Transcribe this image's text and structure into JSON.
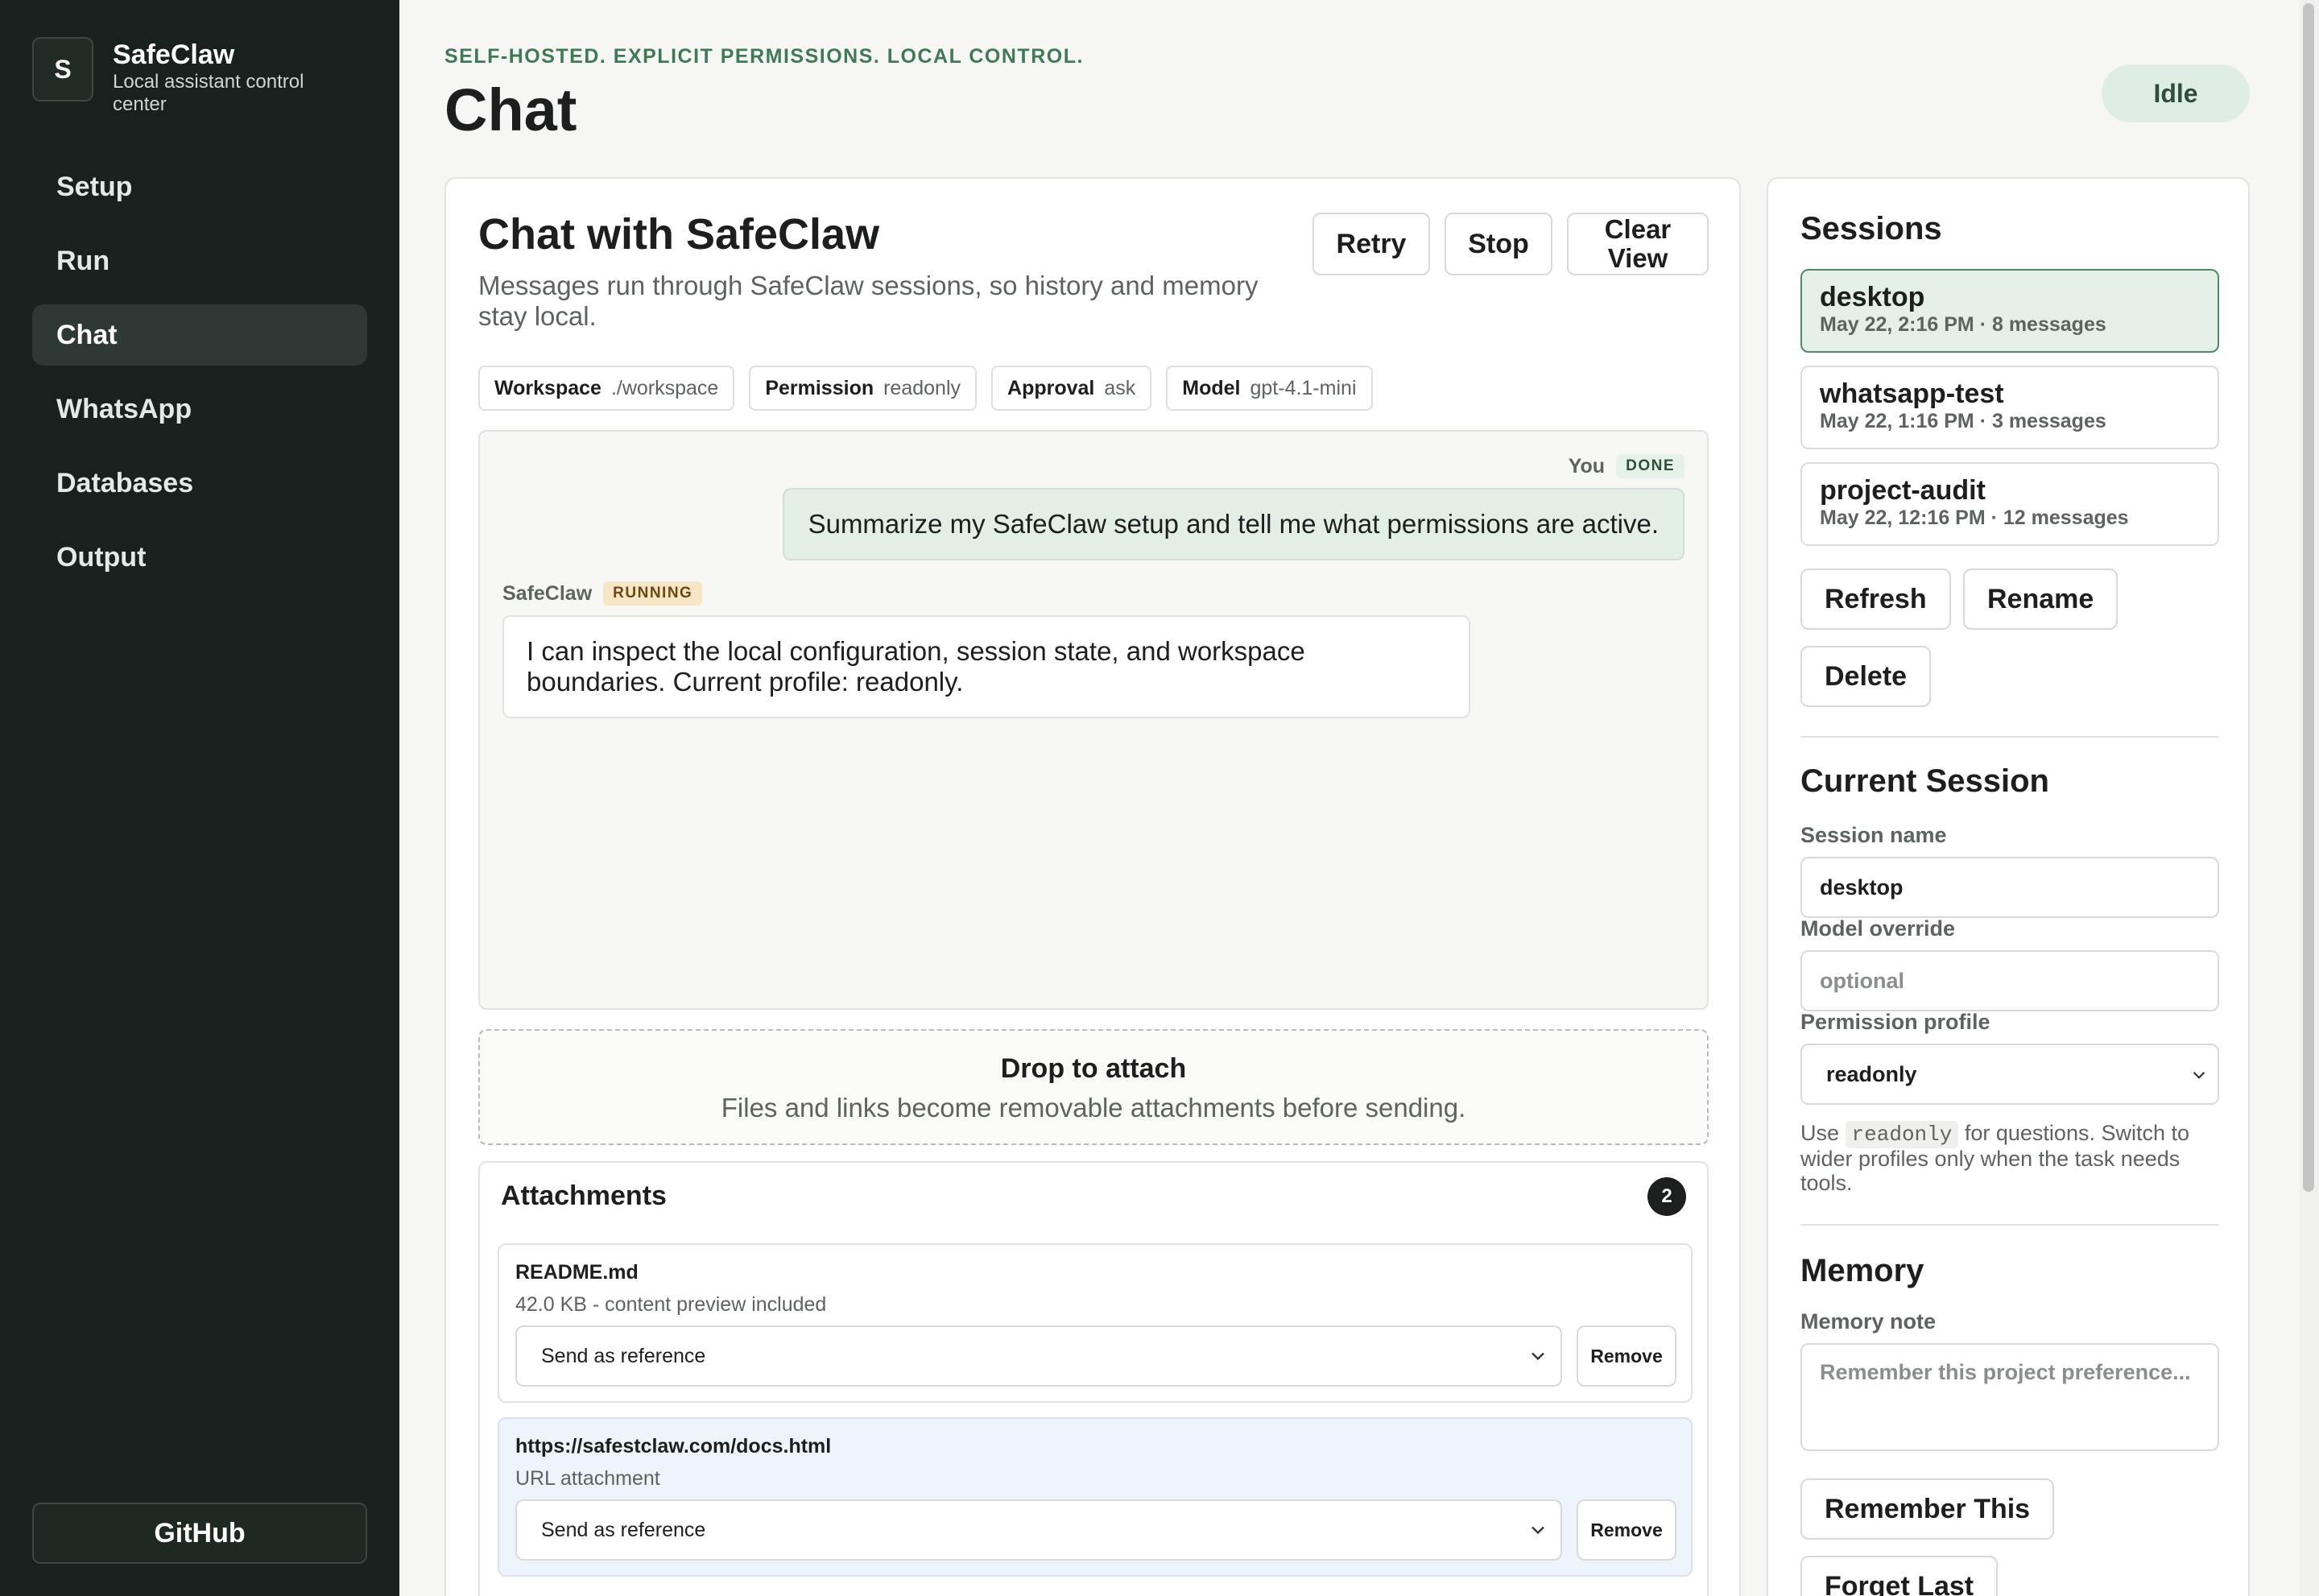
{
  "brand": {
    "initial": "S",
    "name": "SafeClaw",
    "tagline": "Local assistant control center"
  },
  "nav": {
    "items": [
      {
        "label": "Setup"
      },
      {
        "label": "Run"
      },
      {
        "label": "Chat"
      },
      {
        "label": "WhatsApp"
      },
      {
        "label": "Databases"
      },
      {
        "label": "Output"
      }
    ],
    "active": "Chat",
    "github_label": "GitHub"
  },
  "header": {
    "eyebrow": "SELF-HOSTED. EXPLICIT PERMISSIONS. LOCAL CONTROL.",
    "title": "Chat",
    "status": "Idle"
  },
  "chat": {
    "title": "Chat with SafeClaw",
    "subtitle": "Messages run through SafeClaw sessions, so history and memory stay local.",
    "buttons": {
      "retry": "Retry",
      "stop": "Stop",
      "clear": "Clear View"
    },
    "chips": [
      {
        "key": "Workspace",
        "value": "./workspace"
      },
      {
        "key": "Permission",
        "value": "readonly"
      },
      {
        "key": "Approval",
        "value": "ask"
      },
      {
        "key": "Model",
        "value": "gpt-4.1-mini"
      }
    ],
    "messages": {
      "user": {
        "author": "You",
        "status": "DONE",
        "text": "Summarize my SafeClaw setup and tell me what permissions are active."
      },
      "assistant": {
        "author": "SafeClaw",
        "status": "RUNNING",
        "text": "I can inspect the local configuration, session state, and workspace boundaries. Current profile: readonly."
      }
    },
    "dropzone": {
      "title": "Drop to attach",
      "subtitle": "Files and links become removable attachments before sending."
    },
    "attachments": {
      "title": "Attachments",
      "count": "2",
      "items": [
        {
          "name": "README.md",
          "meta": "42.0 KB - content preview included",
          "mode": "Send as reference",
          "remove": "Remove"
        },
        {
          "name": "https://safestclaw.com/docs.html",
          "meta": "URL attachment",
          "mode": "Send as reference",
          "remove": "Remove"
        }
      ]
    }
  },
  "sessions": {
    "title": "Sessions",
    "list": [
      {
        "name": "desktop",
        "meta": "May 22, 2:16 PM · 8 messages"
      },
      {
        "name": "whatsapp-test",
        "meta": "May 22, 1:16 PM · 3 messages"
      },
      {
        "name": "project-audit",
        "meta": "May 22, 12:16 PM · 12 messages"
      }
    ],
    "active": "desktop",
    "buttons": {
      "refresh": "Refresh",
      "rename": "Rename",
      "delete": "Delete"
    }
  },
  "current_session": {
    "title": "Current Session",
    "session_name_label": "Session name",
    "session_name_value": "desktop",
    "model_label": "Model override",
    "model_placeholder": "optional",
    "permission_label": "Permission profile",
    "permission_value": "readonly",
    "help_prefix": "Use",
    "help_code": "readonly",
    "help_suffix": "for questions. Switch to wider profiles only when the task needs tools."
  },
  "memory": {
    "title": "Memory",
    "note_label": "Memory note",
    "note_placeholder": "Remember this project preference...",
    "remember_button": "Remember This",
    "forget_button": "Forget Last"
  },
  "colors": {
    "sidebar_bg": "#18211d",
    "accent_green": "#3f7a55",
    "active_session_bg": "#e4f0e7",
    "running_badge": "#f6e6c6"
  }
}
